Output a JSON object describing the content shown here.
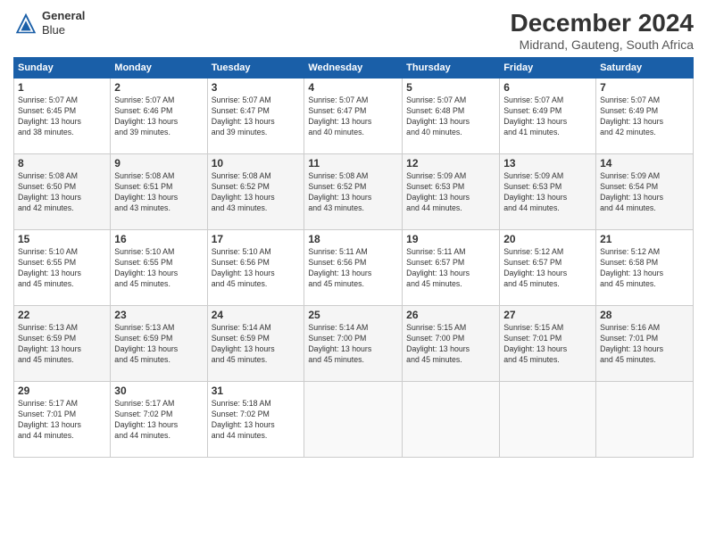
{
  "header": {
    "logo_general": "General",
    "logo_blue": "Blue",
    "month_title": "December 2024",
    "subtitle": "Midrand, Gauteng, South Africa"
  },
  "days_of_week": [
    "Sunday",
    "Monday",
    "Tuesday",
    "Wednesday",
    "Thursday",
    "Friday",
    "Saturday"
  ],
  "weeks": [
    [
      {
        "num": "1",
        "info": "Sunrise: 5:07 AM\nSunset: 6:45 PM\nDaylight: 13 hours\nand 38 minutes."
      },
      {
        "num": "2",
        "info": "Sunrise: 5:07 AM\nSunset: 6:46 PM\nDaylight: 13 hours\nand 39 minutes."
      },
      {
        "num": "3",
        "info": "Sunrise: 5:07 AM\nSunset: 6:47 PM\nDaylight: 13 hours\nand 39 minutes."
      },
      {
        "num": "4",
        "info": "Sunrise: 5:07 AM\nSunset: 6:47 PM\nDaylight: 13 hours\nand 40 minutes."
      },
      {
        "num": "5",
        "info": "Sunrise: 5:07 AM\nSunset: 6:48 PM\nDaylight: 13 hours\nand 40 minutes."
      },
      {
        "num": "6",
        "info": "Sunrise: 5:07 AM\nSunset: 6:49 PM\nDaylight: 13 hours\nand 41 minutes."
      },
      {
        "num": "7",
        "info": "Sunrise: 5:07 AM\nSunset: 6:49 PM\nDaylight: 13 hours\nand 42 minutes."
      }
    ],
    [
      {
        "num": "8",
        "info": "Sunrise: 5:08 AM\nSunset: 6:50 PM\nDaylight: 13 hours\nand 42 minutes."
      },
      {
        "num": "9",
        "info": "Sunrise: 5:08 AM\nSunset: 6:51 PM\nDaylight: 13 hours\nand 43 minutes."
      },
      {
        "num": "10",
        "info": "Sunrise: 5:08 AM\nSunset: 6:52 PM\nDaylight: 13 hours\nand 43 minutes."
      },
      {
        "num": "11",
        "info": "Sunrise: 5:08 AM\nSunset: 6:52 PM\nDaylight: 13 hours\nand 43 minutes."
      },
      {
        "num": "12",
        "info": "Sunrise: 5:09 AM\nSunset: 6:53 PM\nDaylight: 13 hours\nand 44 minutes."
      },
      {
        "num": "13",
        "info": "Sunrise: 5:09 AM\nSunset: 6:53 PM\nDaylight: 13 hours\nand 44 minutes."
      },
      {
        "num": "14",
        "info": "Sunrise: 5:09 AM\nSunset: 6:54 PM\nDaylight: 13 hours\nand 44 minutes."
      }
    ],
    [
      {
        "num": "15",
        "info": "Sunrise: 5:10 AM\nSunset: 6:55 PM\nDaylight: 13 hours\nand 45 minutes."
      },
      {
        "num": "16",
        "info": "Sunrise: 5:10 AM\nSunset: 6:55 PM\nDaylight: 13 hours\nand 45 minutes."
      },
      {
        "num": "17",
        "info": "Sunrise: 5:10 AM\nSunset: 6:56 PM\nDaylight: 13 hours\nand 45 minutes."
      },
      {
        "num": "18",
        "info": "Sunrise: 5:11 AM\nSunset: 6:56 PM\nDaylight: 13 hours\nand 45 minutes."
      },
      {
        "num": "19",
        "info": "Sunrise: 5:11 AM\nSunset: 6:57 PM\nDaylight: 13 hours\nand 45 minutes."
      },
      {
        "num": "20",
        "info": "Sunrise: 5:12 AM\nSunset: 6:57 PM\nDaylight: 13 hours\nand 45 minutes."
      },
      {
        "num": "21",
        "info": "Sunrise: 5:12 AM\nSunset: 6:58 PM\nDaylight: 13 hours\nand 45 minutes."
      }
    ],
    [
      {
        "num": "22",
        "info": "Sunrise: 5:13 AM\nSunset: 6:59 PM\nDaylight: 13 hours\nand 45 minutes."
      },
      {
        "num": "23",
        "info": "Sunrise: 5:13 AM\nSunset: 6:59 PM\nDaylight: 13 hours\nand 45 minutes."
      },
      {
        "num": "24",
        "info": "Sunrise: 5:14 AM\nSunset: 6:59 PM\nDaylight: 13 hours\nand 45 minutes."
      },
      {
        "num": "25",
        "info": "Sunrise: 5:14 AM\nSunset: 7:00 PM\nDaylight: 13 hours\nand 45 minutes."
      },
      {
        "num": "26",
        "info": "Sunrise: 5:15 AM\nSunset: 7:00 PM\nDaylight: 13 hours\nand 45 minutes."
      },
      {
        "num": "27",
        "info": "Sunrise: 5:15 AM\nSunset: 7:01 PM\nDaylight: 13 hours\nand 45 minutes."
      },
      {
        "num": "28",
        "info": "Sunrise: 5:16 AM\nSunset: 7:01 PM\nDaylight: 13 hours\nand 45 minutes."
      }
    ],
    [
      {
        "num": "29",
        "info": "Sunrise: 5:17 AM\nSunset: 7:01 PM\nDaylight: 13 hours\nand 44 minutes."
      },
      {
        "num": "30",
        "info": "Sunrise: 5:17 AM\nSunset: 7:02 PM\nDaylight: 13 hours\nand 44 minutes."
      },
      {
        "num": "31",
        "info": "Sunrise: 5:18 AM\nSunset: 7:02 PM\nDaylight: 13 hours\nand 44 minutes."
      },
      null,
      null,
      null,
      null
    ]
  ]
}
